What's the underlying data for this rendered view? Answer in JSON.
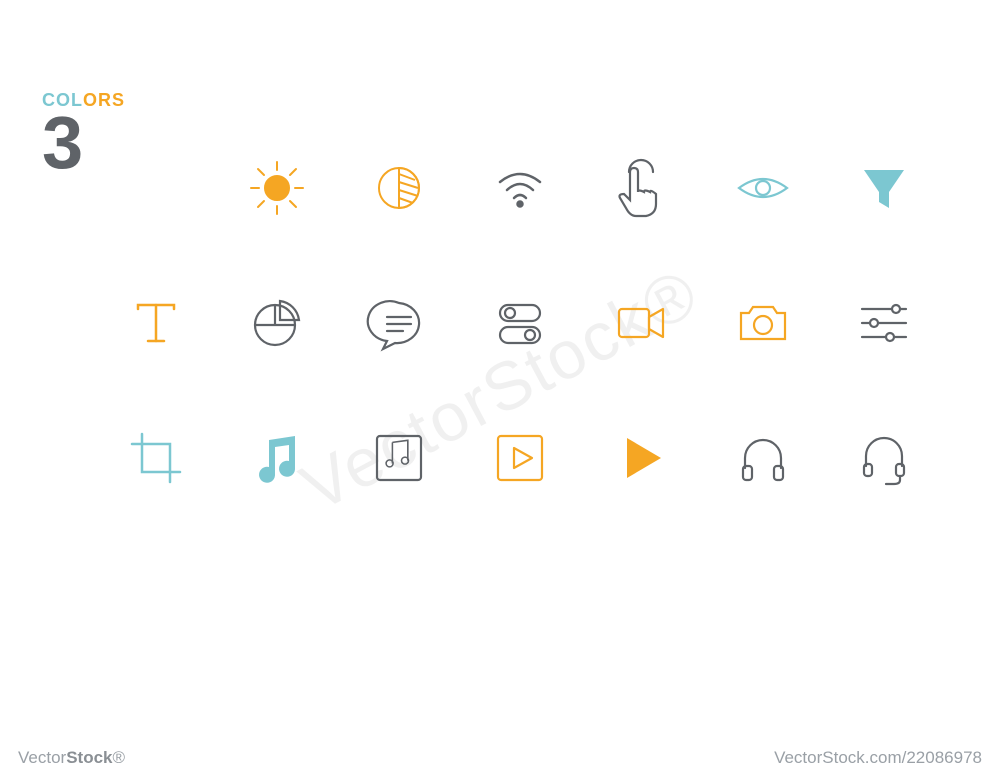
{
  "badge": {
    "label_part1": "COL",
    "label_part2": "ORS",
    "number": "3"
  },
  "colors": {
    "teal": "#7cc7d1",
    "orange": "#f5a623",
    "gray": "#5f6368",
    "light_gray": "#b5bbc0"
  },
  "icons": [
    {
      "name": "brightness-sun-icon",
      "color": "orange",
      "style": "filled"
    },
    {
      "name": "contrast-half-icon",
      "color": "orange",
      "style": "outline"
    },
    {
      "name": "wifi-icon",
      "color": "gray",
      "style": "outline"
    },
    {
      "name": "touch-tap-icon",
      "color": "gray",
      "style": "outline"
    },
    {
      "name": "eye-icon",
      "color": "teal",
      "style": "outline"
    },
    {
      "name": "funnel-filter-icon",
      "color": "teal",
      "style": "filled"
    },
    {
      "name": "text-type-icon",
      "color": "orange",
      "style": "outline"
    },
    {
      "name": "pie-chart-icon",
      "color": "gray",
      "style": "outline"
    },
    {
      "name": "chat-message-icon",
      "color": "gray",
      "style": "outline"
    },
    {
      "name": "toggles-icon",
      "color": "gray",
      "style": "outline"
    },
    {
      "name": "video-camera-icon",
      "color": "orange",
      "style": "outline"
    },
    {
      "name": "photo-camera-icon",
      "color": "orange",
      "style": "outline"
    },
    {
      "name": "sliders-settings-icon",
      "color": "gray",
      "style": "outline"
    },
    {
      "name": "crop-icon",
      "color": "teal",
      "style": "outline"
    },
    {
      "name": "music-note-icon",
      "color": "teal",
      "style": "filled"
    },
    {
      "name": "music-album-icon",
      "color": "gray",
      "style": "outline"
    },
    {
      "name": "play-box-icon",
      "color": "orange",
      "style": "outline"
    },
    {
      "name": "play-triangle-icon",
      "color": "orange",
      "style": "filled"
    },
    {
      "name": "headphones-icon",
      "color": "gray",
      "style": "outline"
    },
    {
      "name": "headset-mic-icon",
      "color": "gray",
      "style": "outline"
    }
  ],
  "watermark": "VectorStock®",
  "footer": {
    "brand_v": "Vector",
    "brand_s": "Stock",
    "suffix": "®",
    "id": "VectorStock.com/22086978"
  }
}
